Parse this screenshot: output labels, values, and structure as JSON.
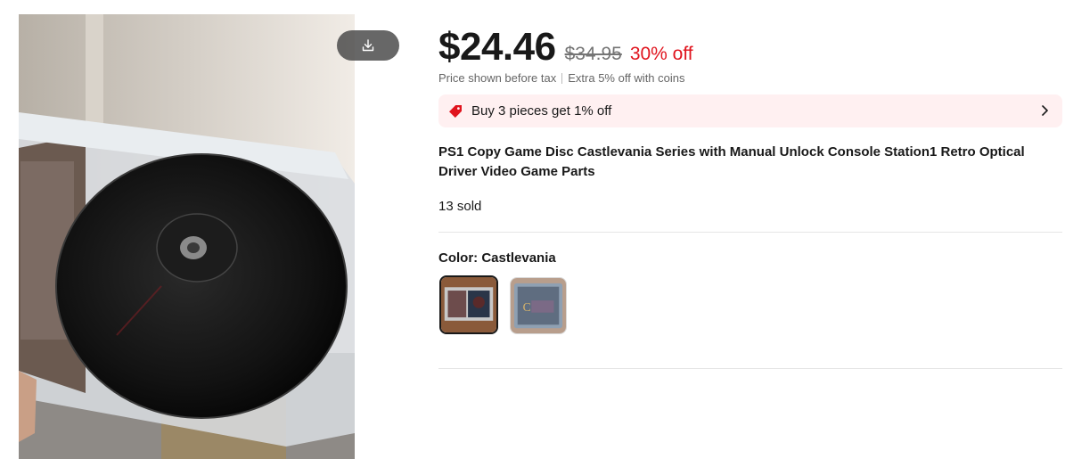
{
  "product_image": {
    "alt": "PS1 game disc in open jewel case"
  },
  "download_button": {
    "icon": "download-icon"
  },
  "price": {
    "current": "$24.46",
    "original": "$34.95",
    "discount": "30% off",
    "note_tax": "Price shown before tax",
    "note_coins": "Extra 5% off with coins"
  },
  "promo": {
    "icon": "tag-icon",
    "text": "Buy 3 pieces get 1% off",
    "chevron": "chevron-right-icon"
  },
  "title": "PS1 Copy Game Disc Castlevania Series with Manual Unlock Console Station1 Retro Optical Driver Video Game Parts",
  "sold": "13 sold",
  "color": {
    "label": "Color: Castlevania",
    "options": [
      {
        "name": "Castlevania",
        "selected": true
      },
      {
        "name": "Castlevania alt",
        "selected": false
      }
    ]
  },
  "colors": {
    "accent": "#e0141e",
    "promo_bg": "#fff0f1",
    "text": "#191919",
    "muted": "#757575"
  }
}
